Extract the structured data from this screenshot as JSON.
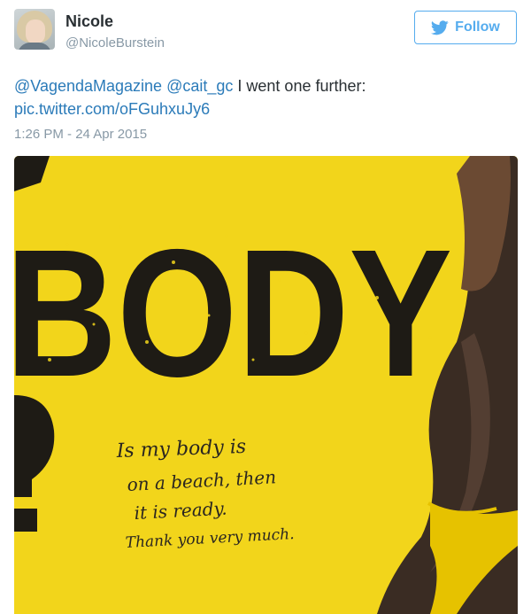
{
  "user": {
    "name": "Nicole",
    "handle": "@NicoleBurstein"
  },
  "follow_button": {
    "label": "Follow",
    "icon": "twitter-bird-icon"
  },
  "tweet": {
    "mention_1": "@VagendaMagazine",
    "mention_2": "@cait_gc",
    "text": "I went one further:",
    "link": "pic.twitter.com/oFGuhxuJy6",
    "timestamp": "1:26 PM - 24 Apr 2015"
  },
  "media": {
    "poster_word": "BODY",
    "handwriting": [
      "Is my body is",
      "on a beach, then",
      "it is ready.",
      "Thank you very much."
    ]
  },
  "colors": {
    "accent": "#55acee",
    "link": "#2b7bb9",
    "poster_yellow": "#f2d51b",
    "poster_ink": "#1e1b15"
  }
}
